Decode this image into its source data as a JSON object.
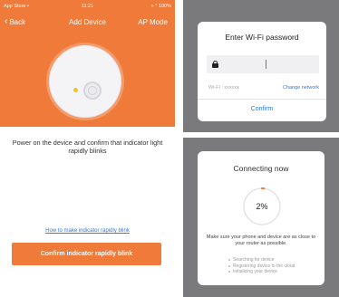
{
  "status_bar": {
    "carrier": "App Store •",
    "time": "11:21",
    "battery": "» ° 100%"
  },
  "nav": {
    "back_label": "Back",
    "title": "Add Device",
    "right_label": "AP Mode"
  },
  "main": {
    "instruction": "Power on the device and confirm that indicator light rapidly blinks",
    "help_link": "How to make indicator rapidly blink",
    "confirm_button": "Confirm indicator rapidly blink"
  },
  "wifi_dialog": {
    "title": "Enter Wi-Fi password",
    "password_value": "",
    "wifi_label": "Wi-Fi : xxxxxx",
    "change_network": "Change network",
    "confirm": "Confirm"
  },
  "connecting_dialog": {
    "title": "Connecting now",
    "progress_percent": 2,
    "progress_label": "2%",
    "message": "Make sure your phone and device are as close to your router as possible.",
    "steps": [
      "Searching for device",
      "Registering device to the cloud",
      "Initializing your device"
    ]
  },
  "colors": {
    "brand_orange": "#ef7a3a",
    "link_blue": "#2f7ad8",
    "overlay_gray": "#7a7a7c"
  }
}
